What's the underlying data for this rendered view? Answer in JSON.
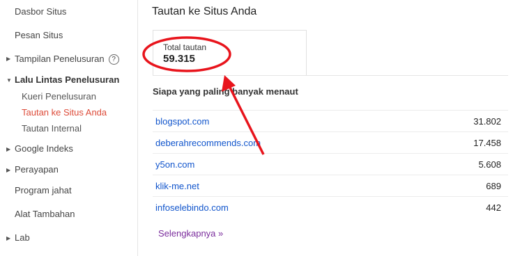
{
  "sidebar": {
    "items": [
      {
        "label": "Dasbor Situs"
      },
      {
        "label": "Pesan Situs"
      },
      {
        "label": "Tampilan Penelusuran",
        "help": "?"
      },
      {
        "label": "Lalu Lintas Penelusuran"
      },
      {
        "label": "Kueri Penelusuran"
      },
      {
        "label": "Tautan ke Situs Anda"
      },
      {
        "label": "Tautan Internal"
      },
      {
        "label": "Google Indeks"
      },
      {
        "label": "Perayapan"
      },
      {
        "label": "Program jahat"
      },
      {
        "label": "Alat Tambahan"
      },
      {
        "label": "Lab"
      }
    ]
  },
  "main": {
    "title": "Tautan ke Situs Anda",
    "total": {
      "label": "Total tautan",
      "value": "59.315"
    },
    "section_title": "Siapa yang paling banyak menaut",
    "rows": [
      {
        "domain": "blogspot.com",
        "count": "31.802"
      },
      {
        "domain": "deberahrecommends.com",
        "count": "17.458"
      },
      {
        "domain": "y5on.com",
        "count": "5.608"
      },
      {
        "domain": "klik-me.net",
        "count": "689"
      },
      {
        "domain": "infoselebindo.com",
        "count": "442"
      }
    ],
    "more_link": "Selengkapnya »"
  },
  "colors": {
    "annotation": "#e8141c",
    "link": "#1155cc",
    "active": "#dd4b39"
  },
  "icons": {
    "expand": "triangle-right-icon",
    "collapse": "triangle-down-icon",
    "help": "question-circle-icon"
  }
}
